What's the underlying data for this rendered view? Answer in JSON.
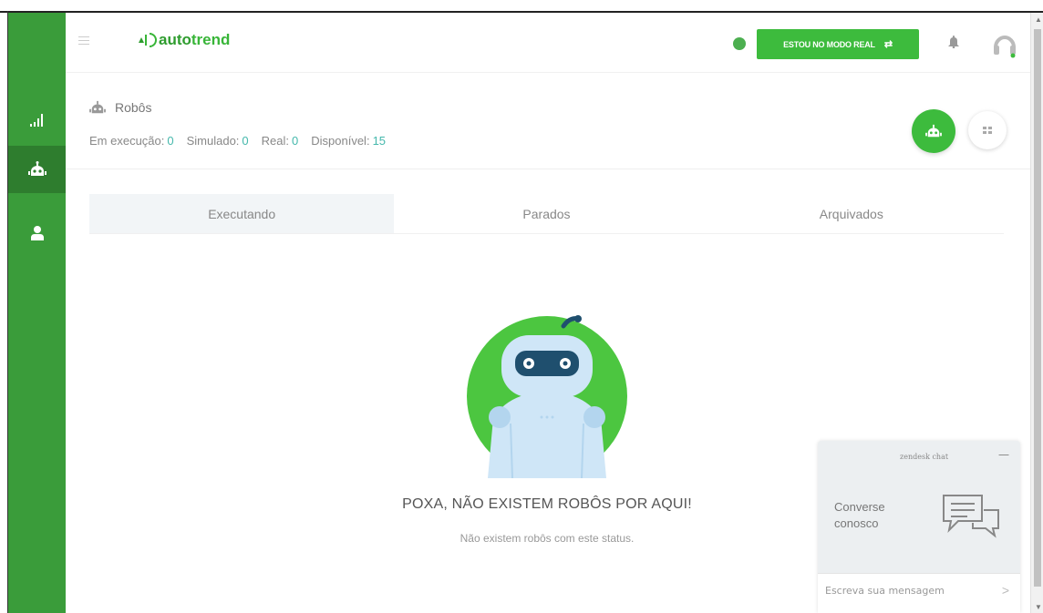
{
  "app": {
    "brand_prefix": "auto",
    "brand_suffix": "trend"
  },
  "topbar": {
    "mode_button_label": "ESTOU NO MODO REAL",
    "mode_button_icon": "swap-icon",
    "status_color": "#4caf50"
  },
  "sidebar": {
    "items": [
      {
        "name": "dashboard",
        "icon": "signal-bars-icon"
      },
      {
        "name": "robots",
        "icon": "robot-icon",
        "active": true
      },
      {
        "name": "user",
        "icon": "user-icon"
      }
    ],
    "color": "#3a9c3a"
  },
  "header": {
    "title": "Robôs",
    "stats": [
      {
        "label": "Em execução:",
        "value": "0"
      },
      {
        "label": "Simulado:",
        "value": "0"
      },
      {
        "label": "Real:",
        "value": "0"
      },
      {
        "label": "Disponível:",
        "value": "15"
      }
    ]
  },
  "tabs": [
    {
      "label": "Executando",
      "active": true
    },
    {
      "label": "Parados",
      "active": false
    },
    {
      "label": "Arquivados",
      "active": false
    }
  ],
  "empty_state": {
    "title": "POXA, NÃO EXISTEM ROBÔS POR AQUI!",
    "subtitle": "Não existem robôs com este status."
  },
  "chat": {
    "header_label": "zendesk chat",
    "minimize": "—",
    "message": "Converse conosco",
    "input_placeholder": "Escreva sua mensagem",
    "send_icon": "send-arrow-icon"
  },
  "colors": {
    "accent": "#3dbb3d",
    "stat_value": "#45b8ac"
  }
}
